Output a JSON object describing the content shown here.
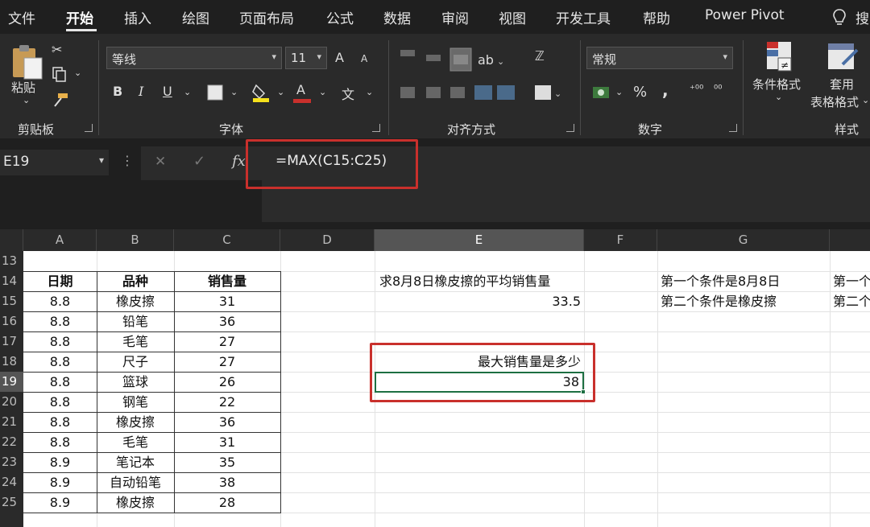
{
  "menu": {
    "tabs": [
      "文件",
      "开始",
      "插入",
      "绘图",
      "页面布局",
      "公式",
      "数据",
      "审阅",
      "视图",
      "开发工具",
      "帮助",
      "Power Pivot"
    ],
    "active": "开始",
    "overflow": "搜"
  },
  "ribbon": {
    "clipboard": {
      "paste_label": "粘贴",
      "group_label": "剪贴板"
    },
    "font": {
      "font_name": "等线",
      "font_size": "11",
      "grow": "A",
      "shrink": "A",
      "bold": "B",
      "italic": "I",
      "underline": "U",
      "fill_letter": "A",
      "group_label": "字体"
    },
    "alignment": {
      "group_label": "对齐方式"
    },
    "number": {
      "format": "常规",
      "percent": "%",
      "comma": ",",
      "group_label": "数字"
    },
    "styles": {
      "cond_format": "条件格式",
      "table_format_1": "套用",
      "table_format_2": "表格格式",
      "group_label": "样式"
    },
    "colors": {
      "accent_red": "#c9302c",
      "fill_yellow": "#f5e11c"
    }
  },
  "formula_bar": {
    "name_box": "E19",
    "cancel": "✕",
    "enter": "✓",
    "fx": "fx",
    "formula": "=MAX(C15:C25)"
  },
  "grid": {
    "columns": [
      "A",
      "B",
      "C",
      "D",
      "E",
      "F",
      "G"
    ],
    "selected_column": "E",
    "rows": [
      "13",
      "14",
      "15",
      "16",
      "17",
      "18",
      "19",
      "20",
      "21",
      "22",
      "23",
      "24",
      "25"
    ],
    "table_headers": [
      "日期",
      "品种",
      "销售量"
    ],
    "table_rows": [
      [
        "8.8",
        "橡皮擦",
        "31"
      ],
      [
        "8.8",
        "铅笔",
        "36"
      ],
      [
        "8.8",
        "毛笔",
        "27"
      ],
      [
        "8.8",
        "尺子",
        "27"
      ],
      [
        "8.8",
        "篮球",
        "26"
      ],
      [
        "8.8",
        "钢笔",
        "22"
      ],
      [
        "8.8",
        "橡皮擦",
        "36"
      ],
      [
        "8.8",
        "毛笔",
        "31"
      ],
      [
        "8.9",
        "笔记本",
        "35"
      ],
      [
        "8.9",
        "自动铅笔",
        "38"
      ],
      [
        "8.9",
        "橡皮擦",
        "28"
      ]
    ],
    "e14": "求8月8日橡皮擦的平均销售量",
    "e15": "33.5",
    "e18": "最大销售量是多少",
    "e19": "38",
    "g14": "第一个条件是8月8日",
    "g15": "第二个条件是橡皮擦",
    "h14": "第一个",
    "h15": "第二个"
  }
}
